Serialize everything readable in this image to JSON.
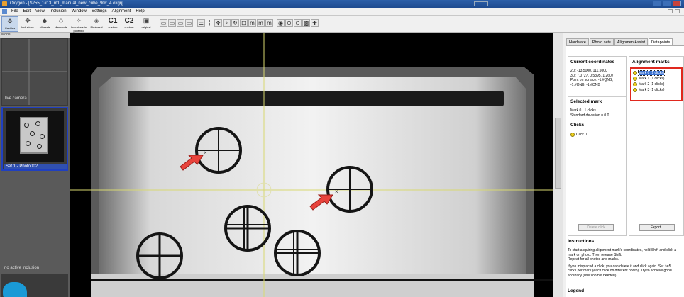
{
  "window": {
    "title": "Oxygen - [S255_1#13_m1_manual_new_cube_90x_4.oxgrj]"
  },
  "menu": [
    "File",
    "Edit",
    "View",
    "Inclusion",
    "Window",
    "Settings",
    "Alignment",
    "Help"
  ],
  "toolbar": {
    "buttons": [
      "Cavities",
      "Inclusions",
      "Alloreals",
      "diamonds",
      "Inclusions in polished",
      "Photoreal",
      "C1",
      "C2",
      "original"
    ],
    "calibration_labels": [
      "custom",
      "custom"
    ]
  },
  "left_panel": {
    "mode_label": "Mode",
    "live_camera": "live camera",
    "photo_label": "Set 1 - Photo002",
    "no_inclusion": "no active inclusion"
  },
  "right_panel": {
    "tabs": [
      "Hardware",
      "Photo sets",
      "AlignmentAssist",
      "Datapoints"
    ],
    "active_tab": "Datapoints",
    "current_coordinates": {
      "title": "Current coordinates",
      "lines": [
        "2D: -13.5000, 111.5000",
        "3D: 7.0727, 0.5395, 1.2607",
        "Point on surface: -1.#QNB,",
        "-1.#QNB, -1.#QNB"
      ]
    },
    "selected_mark": {
      "title": "Selected mark",
      "lines": [
        "Mark 0 : 1 clicks",
        "Standard deviation = 0.0"
      ]
    },
    "clicks": {
      "title": "Clicks",
      "items": [
        "Click 0"
      ]
    },
    "delete_button": "Delete click",
    "alignment_marks": {
      "title": "Alignment marks",
      "items": [
        "Mark 0 (1 clicks)",
        "Mark 1 (1 clicks)",
        "Mark 2 (1 clicks)",
        "Mark 3 (1 clicks)"
      ],
      "selected": "Mark 0 (1 clicks)"
    },
    "export_button": "Export...",
    "instructions": {
      "title": "Instructions",
      "p1": [
        "To start acquiring alignment mark's coordinates, hold Shift and click a",
        "mark on photo. Then release Shift.",
        "Repeat for all photos and marks."
      ],
      "p2": [
        "If you misplaced a click, you can delete it and click again. Set >=5",
        "clicks per mark (each click on different photo). Try to achieve good",
        "accuracy (use zoom if needed)."
      ]
    },
    "legend_title": "Legend"
  },
  "colors": {
    "marker_yellow": "#f2d21a",
    "selection_blue": "#3870d0",
    "highlight_red": "#e0281e",
    "arrow_red": "#e8433c",
    "crosshair": "#d8d870"
  }
}
